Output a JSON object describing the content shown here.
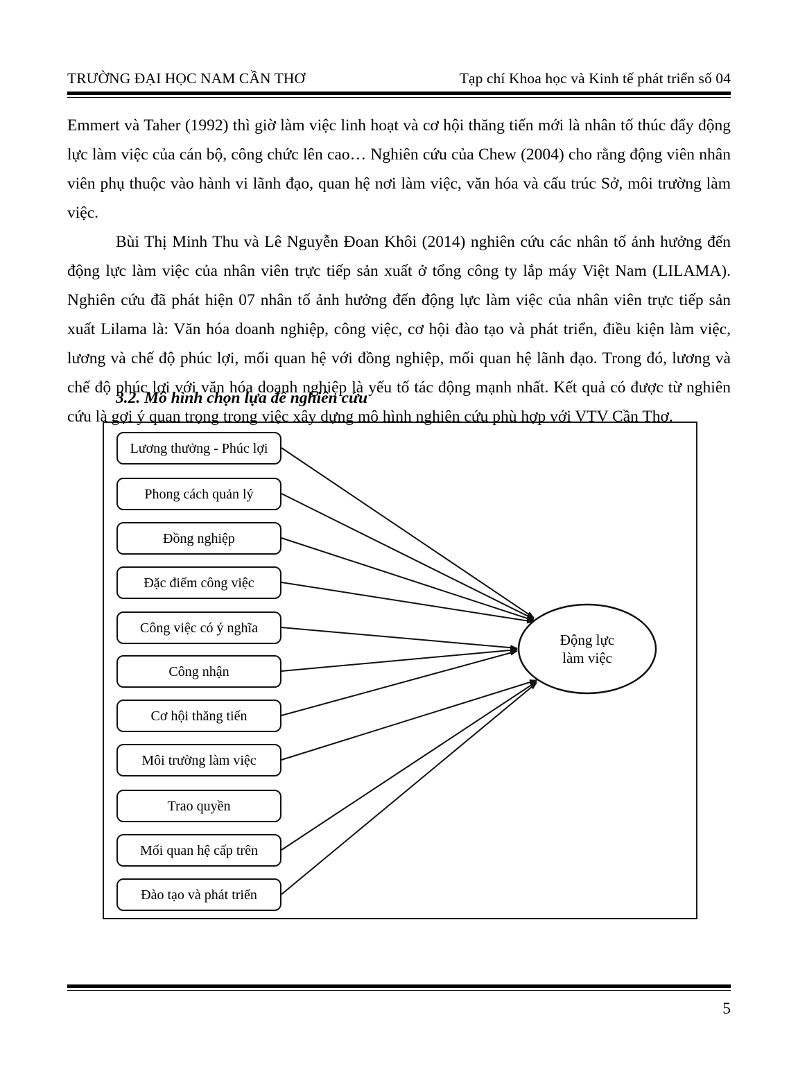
{
  "header": {
    "left": "TRƯỜNG ĐẠI HỌC NAM CẦN THƠ",
    "right": "Tạp chí Khoa học và Kinh tế phát triển số 04"
  },
  "body": {
    "paragraph_1": "Emmert và Taher (1992) thì giờ làm việc linh hoạt và cơ hội thăng tiến mới là nhân tố thúc đẩy động lực làm việc của cán bộ, công chức lên cao… Nghiên cứu của Chew (2004) cho rằng động viên nhân viên phụ thuộc vào hành vi lãnh đạo, quan hệ nơi làm việc, văn hóa và cấu trúc Sở, môi trường làm việc.",
    "paragraph_2": "Bùi Thị Minh Thu và Lê Nguyễn Đoan Khôi (2014) nghiên cứu các nhân tố ảnh hưởng đến động lực làm việc của nhân viên trực tiếp sản xuất ở tổng công ty lắp máy Việt Nam (LILAMA). Nghiên cứu đã phát hiện 07 nhân tố ảnh hưởng đến động lực làm việc của nhân viên trực tiếp sản xuất Lilama là: Văn hóa doanh nghiệp, công việc, cơ hội đào tạo và phát triển, điều kiện làm việc, lương và chế độ phúc lợi, mối quan hệ với đồng nghiệp, mối quan hệ lãnh đạo. Trong đó, lương và chế độ phúc lợi với văn hóa doanh nghiệp là yếu tố tác động mạnh nhất. Kết quả có được từ nghiên cứu là gợi ý quan trọng trong việc xây dựng mô hình nghiên cứu phù hợp với VTV Cần Thơ."
  },
  "section": {
    "heading": "3.2. Mô hình chọn lựa để nghiên cứu"
  },
  "diagram": {
    "type": "research-model-diagram",
    "factors": [
      {
        "label": "Lương thưởng - Phúc lợi",
        "has_arrow": true
      },
      {
        "label": "Phong cách quản lý",
        "has_arrow": true
      },
      {
        "label": "Đồng nghiệp",
        "has_arrow": true
      },
      {
        "label": "Đặc điểm công việc",
        "has_arrow": true
      },
      {
        "label": "Công việc có ý nghĩa",
        "has_arrow": true
      },
      {
        "label": "Công nhận",
        "has_arrow": true
      },
      {
        "label": "Cơ hội thăng tiến",
        "has_arrow": true
      },
      {
        "label": "Môi trường làm việc",
        "has_arrow": true
      },
      {
        "label": "Trao quyền",
        "has_arrow": false
      },
      {
        "label": "Mối quan hệ cấp trên",
        "has_arrow": true
      },
      {
        "label": "Đào tạo và phát triển",
        "has_arrow": true
      }
    ],
    "target": {
      "line1": "Động lực",
      "line2": "làm việc"
    },
    "colors": {
      "stroke": "#111111",
      "background": "#ffffff"
    }
  },
  "footer": {
    "page_number": "5"
  }
}
